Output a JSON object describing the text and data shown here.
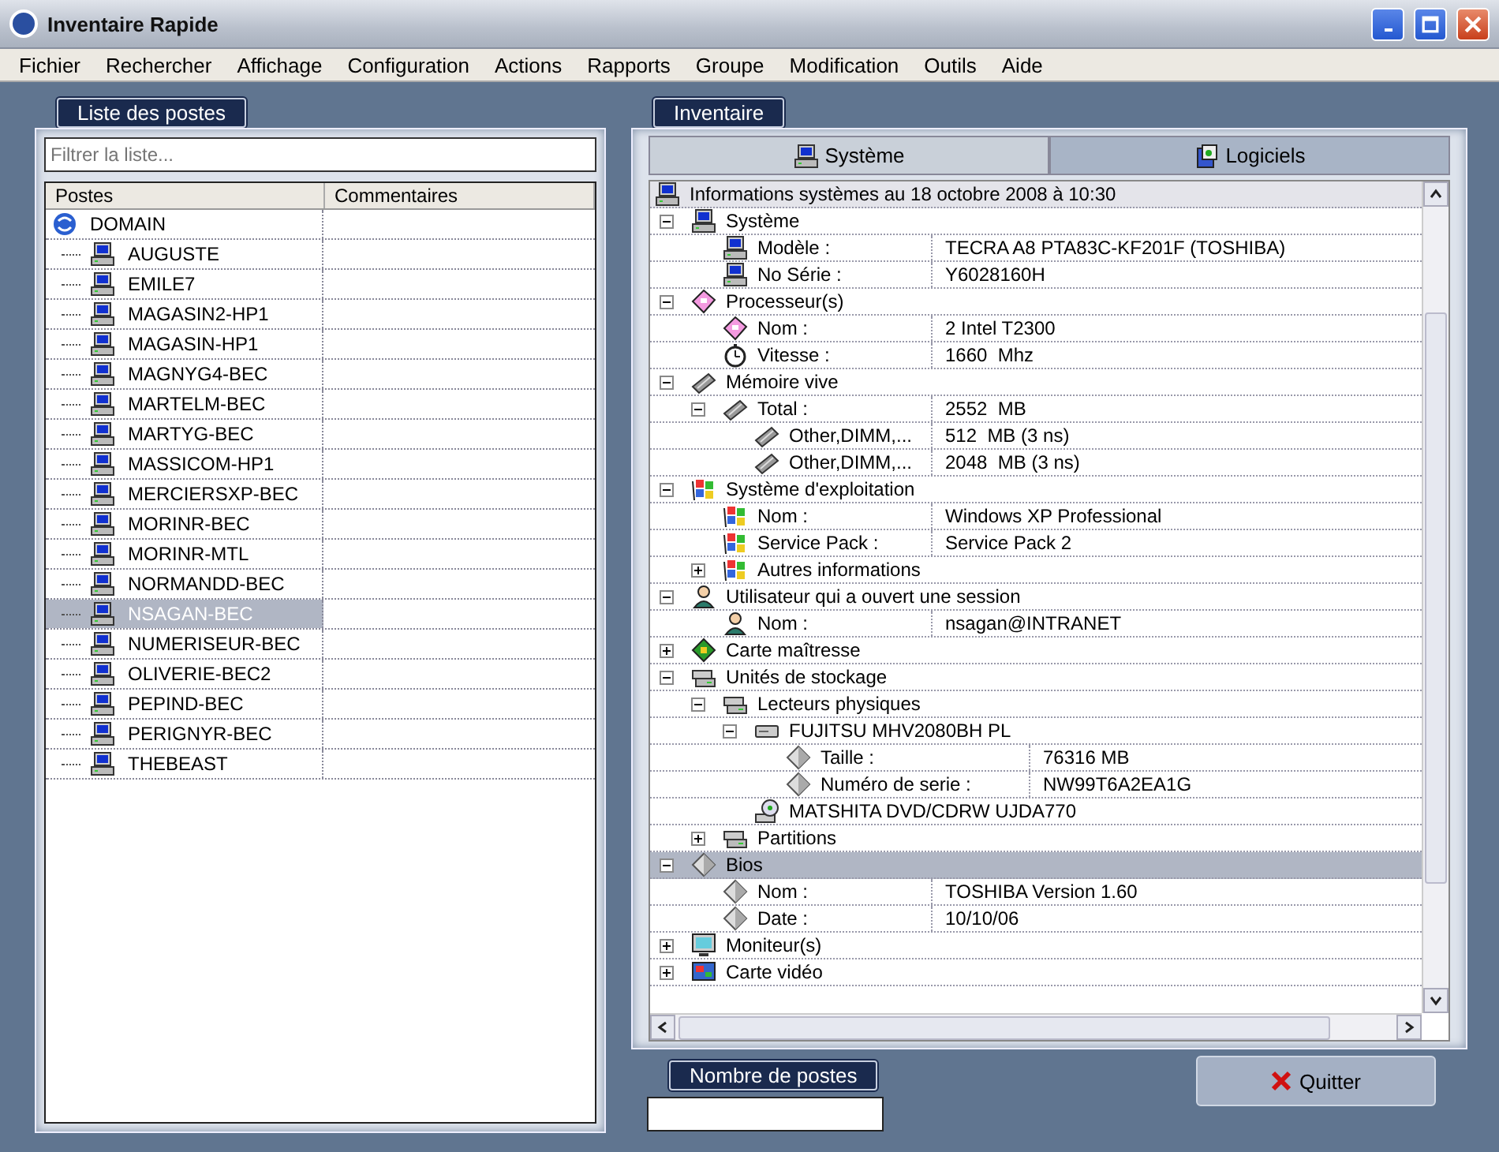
{
  "window": {
    "title": "Inventaire Rapide"
  },
  "menu": [
    "Fichier",
    "Rechercher",
    "Affichage",
    "Configuration",
    "Actions",
    "Rapports",
    "Groupe",
    "Modification",
    "Outils",
    "Aide"
  ],
  "postes_panel": {
    "title": "Liste des postes",
    "filter": {
      "placeholder": "Filtrer la liste..."
    },
    "columns": [
      "Postes",
      "Commentaires"
    ],
    "domain": "DOMAIN",
    "hosts": [
      {
        "name": "AUGUSTE",
        "selected": false
      },
      {
        "name": "EMILE7",
        "selected": false
      },
      {
        "name": "MAGASIN2-HP1",
        "selected": false
      },
      {
        "name": "MAGASIN-HP1",
        "selected": false
      },
      {
        "name": "MAGNYG4-BEC",
        "selected": false
      },
      {
        "name": "MARTELM-BEC",
        "selected": false
      },
      {
        "name": "MARTYG-BEC",
        "selected": false
      },
      {
        "name": "MASSICOM-HP1",
        "selected": false
      },
      {
        "name": "MERCIERSXP-BEC",
        "selected": false
      },
      {
        "name": "MORINR-BEC",
        "selected": false
      },
      {
        "name": "MORINR-MTL",
        "selected": false
      },
      {
        "name": "NORMANDD-BEC",
        "selected": false
      },
      {
        "name": "NSAGAN-BEC",
        "selected": true
      },
      {
        "name": "NUMERISEUR-BEC",
        "selected": false
      },
      {
        "name": "OLIVERIE-BEC2",
        "selected": false
      },
      {
        "name": "PEPIND-BEC",
        "selected": false
      },
      {
        "name": "PERIGNYR-BEC",
        "selected": false
      },
      {
        "name": "THEBEAST",
        "selected": false
      }
    ]
  },
  "inventaire": {
    "title": "Inventaire",
    "tabs": [
      {
        "label": "Système",
        "kind": "computer",
        "selected": true
      },
      {
        "label": "Logiciels",
        "kind": "software",
        "selected": false
      }
    ],
    "header": "Informations systèmes au 18 octobre 2008 à 10:30",
    "tree": [
      {
        "label": "Système",
        "kind": "computer",
        "expanded": true,
        "selected": false,
        "children": [
          {
            "label": "Modèle :",
            "value": "TECRA A8 PTA83C-KF201F (TOSHIBA)",
            "kind": "computer",
            "selected": false
          },
          {
            "label": "No Série :",
            "value": "Y6028160H",
            "kind": "computer",
            "selected": false
          }
        ]
      },
      {
        "label": "Processeur(s)",
        "kind": "cpu",
        "expanded": true,
        "selected": false,
        "children": [
          {
            "label": "Nom :",
            "value": "2 Intel T2300",
            "kind": "cpu",
            "selected": false
          },
          {
            "label": "Vitesse :",
            "value": "1660  Mhz",
            "kind": "clock",
            "selected": false
          }
        ]
      },
      {
        "label": "Mémoire vive",
        "kind": "memory",
        "expanded": true,
        "selected": false,
        "children": [
          {
            "label": "Total :",
            "value": "2552  MB",
            "kind": "memory",
            "expanded": true,
            "selected": false,
            "children": [
              {
                "label": "Other,DIMM,...",
                "value": "512  MB (3 ns)",
                "kind": "memory",
                "selected": false
              },
              {
                "label": "Other,DIMM,...",
                "value": "2048  MB (3 ns)",
                "kind": "memory",
                "selected": false
              }
            ]
          }
        ]
      },
      {
        "label": "Système d'exploitation",
        "kind": "windows",
        "expanded": true,
        "selected": false,
        "children": [
          {
            "label": "Nom :",
            "value": "Windows XP Professional",
            "kind": "windows",
            "selected": false
          },
          {
            "label": "Service Pack :",
            "value": "Service Pack 2",
            "kind": "windows",
            "selected": false
          },
          {
            "label": "Autres informations",
            "kind": "windows",
            "expanded": false,
            "selected": false
          }
        ]
      },
      {
        "label": "Utilisateur qui a ouvert une session",
        "kind": "user",
        "expanded": true,
        "selected": false,
        "children": [
          {
            "label": "Nom :",
            "value": "nsagan@INTRANET",
            "kind": "user",
            "selected": false
          }
        ]
      },
      {
        "label": "Carte maîtresse",
        "kind": "board",
        "expanded": false,
        "selected": false
      },
      {
        "label": "Unités de stockage",
        "kind": "storage",
        "expanded": true,
        "selected": false,
        "children": [
          {
            "label": "Lecteurs physiques",
            "kind": "storage",
            "expanded": true,
            "selected": false,
            "children": [
              {
                "label": "FUJITSU MHV2080BH PL",
                "kind": "disk",
                "expanded": true,
                "selected": false,
                "children": [
                  {
                    "label": "Taille :",
                    "value": "76316 MB",
                    "kind": "diamond",
                    "selected": false
                  },
                  {
                    "label": "Numéro de serie :",
                    "value": "NW99T6A2EA1G",
                    "kind": "diamond",
                    "selected": false
                  }
                ]
              },
              {
                "label": "MATSHITA DVD/CDRW UJDA770",
                "kind": "cdrom",
                "selected": false
              }
            ]
          },
          {
            "label": "Partitions",
            "kind": "storage",
            "expanded": false,
            "selected": false
          }
        ]
      },
      {
        "label": "Bios",
        "kind": "diamond",
        "expanded": true,
        "selected": true,
        "children": [
          {
            "label": "Nom :",
            "value": "TOSHIBA Version 1.60",
            "kind": "diamond",
            "selected": false
          },
          {
            "label": "Date :",
            "value": "10/10/06",
            "kind": "diamond",
            "selected": false
          }
        ]
      },
      {
        "label": "Moniteur(s)",
        "kind": "monitor",
        "expanded": false,
        "selected": false
      },
      {
        "label": "Carte vidéo",
        "kind": "video",
        "expanded": false,
        "selected": false
      }
    ]
  },
  "count": {
    "title": "Nombre de postes"
  },
  "quit_button": "Quitter"
}
